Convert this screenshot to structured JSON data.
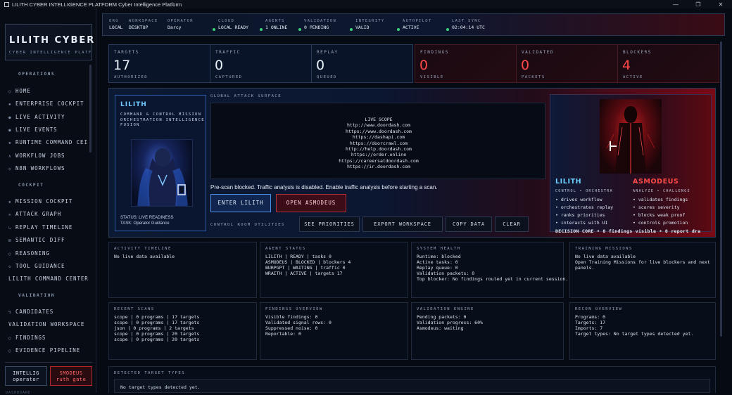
{
  "window": {
    "title": "LILITH CYBER INTELLIGENCE PLATFORM Cyber Intelligence Platform",
    "minimize": "—",
    "maximize": "❐",
    "close": "✕"
  },
  "sidebar": {
    "brand": "LILITH CYBER",
    "subtitle": "CYBER INTELLIGENCE PLATFO",
    "sections": [
      {
        "label": "OPERATIONS"
      },
      {
        "label": "COCKPIT"
      },
      {
        "label": "VALIDATION"
      }
    ],
    "items": [
      {
        "icon": "○",
        "label": "HOME"
      },
      {
        "icon": "▪",
        "label": "ENTERPRISE COCKPIT"
      },
      {
        "icon": "●",
        "label": "LIVE ACTIVITY"
      },
      {
        "icon": "●",
        "label": "LIVE EVENTS"
      },
      {
        "icon": "▪",
        "label": "RUNTIME COMMAND CEI"
      },
      {
        "icon": "∧",
        "label": "WORKFLOW JOBS"
      },
      {
        "icon": "◇",
        "label": "N8N WORKFLOWS"
      },
      {
        "icon": "▪",
        "label": "MISSION COCKPIT"
      },
      {
        "icon": "✲",
        "label": "ATTACK GRAPH"
      },
      {
        "icon": "↳",
        "label": "REPLAY TIMELINE"
      },
      {
        "icon": "⊞",
        "label": "SEMANTIC DIFF"
      },
      {
        "icon": "○",
        "label": "REASONING"
      },
      {
        "icon": "◇",
        "label": "TOOL GUIDANCE"
      },
      {
        "icon": "",
        "label": "LILITH COMMAND CENTER"
      },
      {
        "icon": "↯",
        "label": "CANDIDATES"
      },
      {
        "icon": "",
        "label": "VALIDATION WORKSPACE"
      },
      {
        "icon": "○",
        "label": "FINDINGS"
      },
      {
        "icon": "○",
        "label": "EVIDENCE PIPELINE"
      }
    ],
    "operator_btn": {
      "line1": "INTELLIG",
      "line2": "operator"
    },
    "target_btn": {
      "line1": "SMODEUS",
      "line2": "ruth gate"
    },
    "footer": "DASHBOARD"
  },
  "topbar": [
    {
      "label": "ORG",
      "value": "LOCAL",
      "dot": ""
    },
    {
      "label": "WORKSPACE",
      "value": "DESKTOP",
      "dot": ""
    },
    {
      "label": "OPERATOR",
      "value": "Darcy",
      "dot": ""
    },
    {
      "label": "CLOUD",
      "value": "LOCAL READY",
      "dot": "#3ad17a"
    },
    {
      "label": "AGENTS",
      "value": "1 ONLINE",
      "dot": "#3ad17a"
    },
    {
      "label": "VALIDATION",
      "value": "0 PENDING",
      "dot": "#3ad17a"
    },
    {
      "label": "INTEGRITY",
      "value": "VALID",
      "dot": "#3ad17a"
    },
    {
      "label": "AUTOPILOT",
      "value": "ACTIVE",
      "dot": "#3ad17a"
    },
    {
      "label": "LAST SYNC",
      "value": "02:04:14 UTC",
      "dot": "#3ad17a"
    }
  ],
  "stats": [
    {
      "label": "TARGETS",
      "value": "17",
      "sub": "AUTHORIZED",
      "red": false
    },
    {
      "label": "TRAFFIC",
      "value": "0",
      "sub": "CAPTURED",
      "red": false
    },
    {
      "label": "REPLAY",
      "value": "0",
      "sub": "QUEUED",
      "red": false
    },
    {
      "label": "FINDINGS",
      "value": "0",
      "sub": "VISIBLE",
      "red": true
    },
    {
      "label": "VALIDATED",
      "value": "0",
      "sub": "PACKETS",
      "red": true
    },
    {
      "label": "BLOCKERS",
      "value": "4",
      "sub": "ACTIVE",
      "red": true
    }
  ],
  "hero": {
    "lilith_name": "LILITH",
    "lilith_role": "COMMAND & CONTROL MISSION ORCHESTRATION INTELLIGENCE FUSION",
    "status_line1": "STATUS: LIVE READINESS",
    "status_line2": "TASK: Operator Guidance",
    "surface_title": "GLOBAL ATTACK SURFACE",
    "scope_lines": [
      "LIVE SCOPE",
      "http://www.doordash.com",
      "https://www.doordash.com",
      "https://dashapi.com",
      "https://doorcrawl.com",
      "http://help.doordash.com",
      "https://order.online",
      "https://careersatdoordash.com",
      "https://ir.doordash.com"
    ],
    "prescan": "Pre-scan blocked. Traffic analysis is disabled. Enable traffic analysis before starting a scan.",
    "enter_btn": "ENTER LILITH",
    "open_btn": "OPEN ASMODEUS",
    "util_label": "CONTROL ROOM UTILITIES",
    "utilities": [
      "SEE PRIORITIES",
      "EXPORT WORKSPACE",
      "COPY DATA",
      "CLEAR"
    ],
    "lilith_col": {
      "name": "LILITH",
      "sub": "CONTROL • ORCHESTRA",
      "items": [
        "• drives workflow",
        "• orchestrates replay",
        "• ranks priorities",
        "• interacts with UI"
      ]
    },
    "asmodeus_col": {
      "name": "ASMODEUS",
      "sub": "ANALYZE • CHALLENGE",
      "items": [
        "• validates findings",
        "• scores severity",
        "• blocks weak proof",
        "• controls promotion"
      ]
    },
    "decision": "DECISION CORE • 0 findings visible • 0 report dra"
  },
  "panels": [
    {
      "title": "ACTIVITY TIMELINE",
      "body": "No live data available"
    },
    {
      "title": "AGENT STATUS",
      "body": "LILITH | READY | tasks 0\nASMODEUS | BLOCKED | blockers 4\nBURPGPT | WAITING | traffic 0\nWRAITH | ACTIVE | targets 17"
    },
    {
      "title": "SYSTEM HEALTH",
      "body": "Runtime: blocked\nActive tasks: 0\nReplay queue: 0\nValidation packets: 0\nTop blocker: No findings routed yet in current session."
    },
    {
      "title": "TRAINING MISSIONS",
      "body": "No live data available\nOpen Training Missions for live blockers and next\npanels."
    },
    {
      "title": "RECENT SCANS",
      "body": "scope | 0 programs | 17 targets\nscope | 0 programs | 17 targets\njson | 0 programs | 2 targets\nscope | 0 programs | 20 targets\nscope | 0 programs | 20 targets"
    },
    {
      "title": "FINDINGS OVERVIEW",
      "body": "Visible findings: 0\nValidated signal rows: 0\nSuppressed noise: 0\nReportable: 0"
    },
    {
      "title": "VALIDATION ENGINE",
      "body": "Pending packets: 0\nValidation progress: 60%\nAsmodeus: waiting"
    },
    {
      "title": "RECON OVERVIEW",
      "body": "Programs: 0\nTargets: 17\nImports: 7\nTarget types: No target types detected yet."
    }
  ],
  "detected": {
    "title": "DETECTED TARGET TYPES",
    "body": "No target types detected yet."
  }
}
